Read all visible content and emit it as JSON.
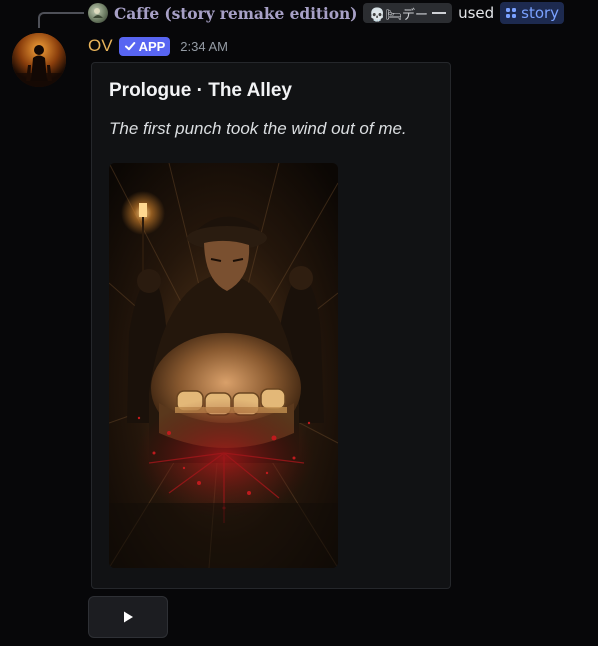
{
  "reply": {
    "username": "Caffe (story remake edition)",
    "user_chip_text": "💀🛏デー",
    "used_text": "used",
    "command": "story",
    "command_icon": "slash-command-icon"
  },
  "message": {
    "author": "OV",
    "badge": "APP",
    "badge_icon": "check-icon",
    "timestamp": "2:34 AM"
  },
  "embed": {
    "title": "Prologue · The Alley",
    "description": "The first punch took the wind out of me.",
    "image_alt": "Illustration of a man in a flat cap punching toward the viewer wearing brass knuckles, dim alley with streetlamp and two men behind, blood spatter"
  },
  "buttons": [
    {
      "icon": "play-icon"
    }
  ],
  "colors": {
    "author": "#e8b35a",
    "app_badge": "#5865f2",
    "reply_name": "#a7a0c6",
    "command": "#7aa1ff",
    "embed_bg": "#111214",
    "background": "#070709"
  }
}
